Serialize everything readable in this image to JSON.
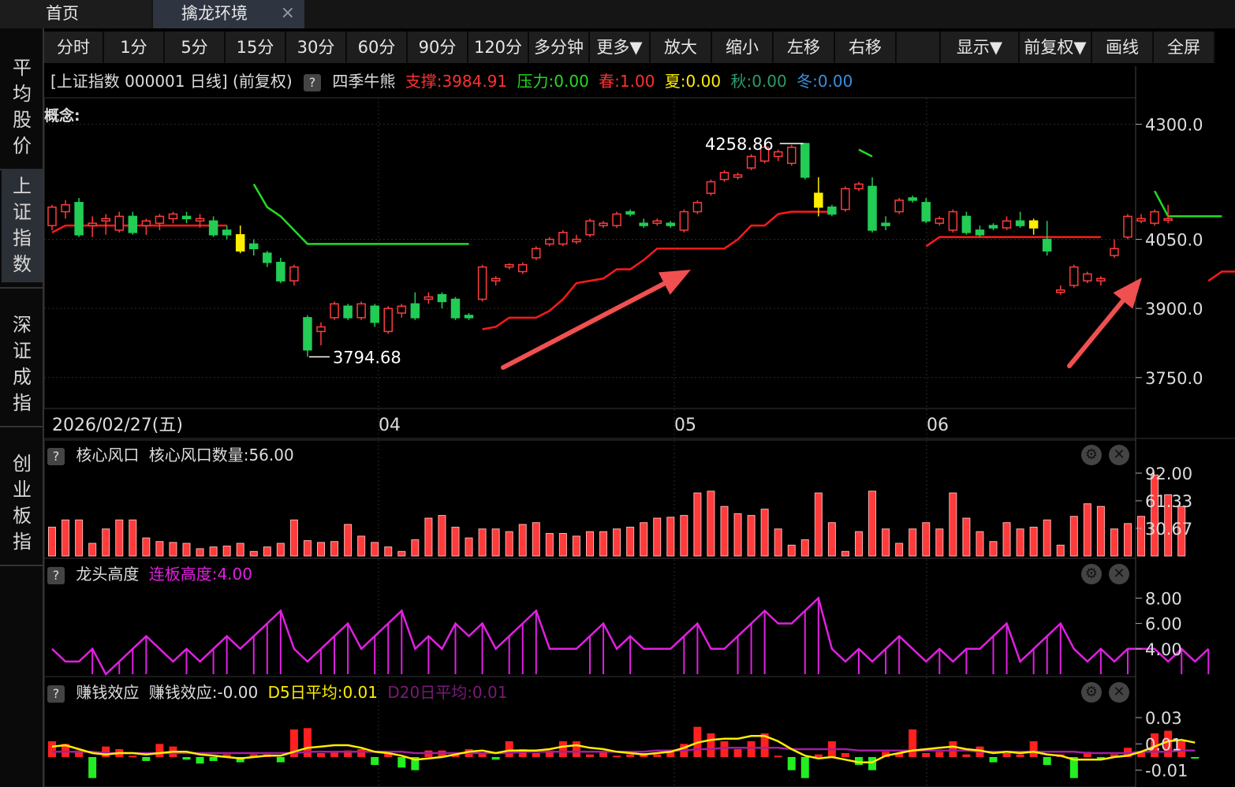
{
  "tabs": {
    "home": "首页",
    "env": "擒龙环境",
    "close": "×"
  },
  "sidebar": [
    "平均股价",
    "上证指数",
    "深证成指",
    "创业板指"
  ],
  "sidebar_active": 1,
  "toolbar": [
    "分时",
    "1分",
    "5分",
    "15分",
    "30分",
    "60分",
    "90分",
    "120分",
    "多分钟",
    "更多▼",
    "放大",
    "缩小",
    "左移",
    "右移",
    "",
    "显示▼",
    "前复权▼",
    "画线",
    "全屏"
  ],
  "info": {
    "title": "[上证指数 000001 日线] (前复权)",
    "help": "?",
    "indicator": "四季牛熊",
    "support": "支撑:3984.91",
    "pressure": "压力:0.00",
    "spring": "春:1.00",
    "summer": "夏:0.00",
    "autumn": "秋:0.00",
    "winter": "冬:0.00"
  },
  "concept_label": "概念:",
  "colors": {
    "up": "#ff3b3b",
    "down": "#22cc55",
    "yellow": "#ffee00",
    "magenta": "#e020e0",
    "support": "#ff1a1a",
    "pressure": "#22dd22"
  },
  "chart_data": [
    {
      "type": "candlestick",
      "yticks": [
        "4300.0",
        "4050.0",
        "3900.0",
        "3750.0"
      ],
      "ylim": [
        3700,
        4330
      ],
      "xticks": [
        "2026/02/27(五)",
        "04",
        "05",
        "06"
      ],
      "annotations": {
        "high": "4258.86",
        "low": "3794.68"
      },
      "candles": [
        [
          4080,
          4120,
          4070,
          4125
        ],
        [
          4110,
          4125,
          4095,
          4135
        ],
        [
          4130,
          4060,
          4055,
          4140
        ],
        [
          4080,
          4085,
          4055,
          4100
        ],
        [
          4090,
          4095,
          4060,
          4105
        ],
        [
          4070,
          4100,
          4065,
          4110
        ],
        [
          4100,
          4065,
          4060,
          4110
        ],
        [
          4080,
          4090,
          4060,
          4095
        ],
        [
          4085,
          4100,
          4070,
          4105
        ],
        [
          4095,
          4105,
          4085,
          4110
        ],
        [
          4100,
          4095,
          4085,
          4110
        ],
        [
          4090,
          4095,
          4075,
          4105
        ],
        [
          4090,
          4060,
          4055,
          4100
        ],
        [
          4070,
          4060,
          4050,
          4080
        ],
        [
          4060,
          4025,
          4020,
          4080
        ],
        [
          4040,
          4030,
          4015,
          4050
        ],
        [
          4020,
          4000,
          3990,
          4025
        ],
        [
          4000,
          3960,
          3955,
          4010
        ],
        [
          3960,
          3990,
          3950,
          3995
        ],
        [
          3880,
          3810,
          3795,
          3885
        ],
        [
          3850,
          3860,
          3820,
          3870
        ],
        [
          3880,
          3910,
          3875,
          3915
        ],
        [
          3905,
          3880,
          3875,
          3910
        ],
        [
          3880,
          3910,
          3875,
          3915
        ],
        [
          3905,
          3870,
          3860,
          3910
        ],
        [
          3850,
          3900,
          3845,
          3905
        ],
        [
          3890,
          3905,
          3880,
          3910
        ],
        [
          3910,
          3880,
          3875,
          3935
        ],
        [
          3920,
          3925,
          3910,
          3935
        ],
        [
          3930,
          3915,
          3900,
          3935
        ],
        [
          3920,
          3880,
          3875,
          3925
        ],
        [
          3885,
          3880,
          3875,
          3890
        ],
        [
          3920,
          3990,
          3915,
          3995
        ],
        [
          3960,
          3965,
          3950,
          3970
        ],
        [
          3990,
          3995,
          3985,
          3998
        ],
        [
          3980,
          3995,
          3975,
          4000
        ],
        [
          4010,
          4030,
          4005,
          4035
        ],
        [
          4040,
          4050,
          4035,
          4055
        ],
        [
          4040,
          4065,
          4035,
          4070
        ],
        [
          4045,
          4050,
          4040,
          4060
        ],
        [
          4060,
          4090,
          4055,
          4095
        ],
        [
          4080,
          4085,
          4075,
          4090
        ],
        [
          4080,
          4105,
          4075,
          4110
        ],
        [
          4110,
          4105,
          4100,
          4115
        ],
        [
          4085,
          4080,
          4075,
          4095
        ],
        [
          4085,
          4090,
          4080,
          4095
        ],
        [
          4085,
          4080,
          4075,
          4090
        ],
        [
          4070,
          4110,
          4065,
          4115
        ],
        [
          4110,
          4130,
          4105,
          4135
        ],
        [
          4150,
          4175,
          4145,
          4180
        ],
        [
          4180,
          4195,
          4175,
          4200
        ],
        [
          4185,
          4190,
          4180,
          4195
        ],
        [
          4205,
          4230,
          4200,
          4235
        ],
        [
          4220,
          4250,
          4215,
          4258
        ],
        [
          4230,
          4240,
          4220,
          4245
        ],
        [
          4215,
          4250,
          4210,
          4255
        ],
        [
          4258,
          4185,
          4180,
          4260
        ],
        [
          4150,
          4120,
          4100,
          4185
        ],
        [
          4120,
          4105,
          4100,
          4125
        ],
        [
          4115,
          4160,
          4110,
          4165
        ],
        [
          4160,
          4170,
          4155,
          4175
        ],
        [
          4165,
          4070,
          4065,
          4185
        ],
        [
          4085,
          4080,
          4070,
          4100
        ],
        [
          4110,
          4135,
          4105,
          4140
        ],
        [
          4140,
          4135,
          4130,
          4145
        ],
        [
          4130,
          4090,
          4085,
          4140
        ],
        [
          4085,
          4095,
          4080,
          4100
        ],
        [
          4070,
          4110,
          4065,
          4115
        ],
        [
          4100,
          4065,
          4060,
          4110
        ],
        [
          4070,
          4060,
          4055,
          4080
        ],
        [
          4080,
          4075,
          4070,
          4085
        ],
        [
          4075,
          4090,
          4070,
          4100
        ],
        [
          4090,
          4080,
          4075,
          4110
        ],
        [
          4075,
          4090,
          4060,
          4095
        ],
        [
          4050,
          4025,
          4015,
          4090
        ],
        [
          3935,
          3940,
          3930,
          3950
        ],
        [
          3950,
          3990,
          3945,
          3995
        ],
        [
          3960,
          3975,
          3955,
          3980
        ],
        [
          3960,
          3965,
          3950,
          3970
        ],
        [
          4015,
          4030,
          4010,
          4050
        ],
        [
          4055,
          4100,
          4050,
          4105
        ],
        [
          4090,
          4095,
          4085,
          4105
        ],
        [
          4085,
          4110,
          4080,
          4115
        ],
        [
          4095,
          4095,
          4085,
          4125
        ]
      ],
      "support_line": [
        [
          0,
          4065
        ],
        [
          1,
          4080
        ],
        [
          2,
          4080
        ],
        [
          3,
          4080
        ],
        [
          4,
          4080
        ],
        [
          5,
          4080
        ],
        [
          6,
          4080
        ],
        [
          7,
          4080
        ],
        [
          8,
          4080
        ],
        [
          9,
          4080
        ],
        [
          10,
          4080
        ],
        [
          11,
          4080
        ],
        [
          12,
          4080
        ],
        [
          13,
          4080
        ],
        null,
        [
          32,
          3855
        ],
        [
          33,
          3860
        ],
        [
          34,
          3880
        ],
        [
          35,
          3880
        ],
        [
          36,
          3880
        ],
        [
          37,
          3895
        ],
        [
          38,
          3920
        ],
        [
          39,
          3955
        ],
        [
          40,
          3960
        ],
        [
          41,
          3965
        ],
        [
          42,
          3985
        ],
        [
          43,
          3985
        ],
        [
          44,
          4005
        ],
        [
          45,
          4030
        ],
        [
          46,
          4030
        ],
        [
          47,
          4030
        ],
        [
          48,
          4030
        ],
        [
          49,
          4030
        ],
        [
          50,
          4030
        ],
        [
          51,
          4050
        ],
        [
          52,
          4080
        ],
        [
          53,
          4080
        ],
        [
          54,
          4105
        ],
        [
          55,
          4110
        ],
        [
          56,
          4110
        ],
        [
          57,
          4110
        ],
        [
          58,
          4110
        ],
        null,
        [
          65,
          4035
        ],
        [
          66,
          4055
        ],
        [
          67,
          4055
        ],
        [
          68,
          4055
        ],
        [
          69,
          4055
        ],
        [
          70,
          4055
        ],
        [
          71,
          4055
        ],
        [
          72,
          4055
        ],
        [
          73,
          4055
        ],
        [
          74,
          4055
        ],
        [
          75,
          4055
        ],
        [
          76,
          4055
        ],
        [
          77,
          4055
        ],
        [
          78,
          4055
        ],
        null,
        [
          86,
          3960
        ],
        [
          87,
          3980
        ],
        [
          88,
          3980
        ],
        [
          89,
          3985
        ]
      ],
      "pressure_line": [
        [
          15,
          4170
        ],
        [
          16,
          4120
        ],
        [
          17,
          4100
        ],
        [
          18,
          4070
        ],
        [
          19,
          4040
        ],
        [
          20,
          4040
        ],
        [
          21,
          4040
        ],
        [
          22,
          4040
        ],
        [
          23,
          4040
        ],
        [
          24,
          4040
        ],
        [
          25,
          4040
        ],
        [
          26,
          4040
        ],
        [
          27,
          4040
        ],
        [
          28,
          4040
        ],
        [
          29,
          4040
        ],
        [
          30,
          4040
        ],
        [
          31,
          4040
        ],
        null,
        [
          60,
          4245
        ],
        [
          61,
          4230
        ],
        null,
        [
          82,
          4155
        ],
        [
          83,
          4100
        ],
        [
          84,
          4100
        ],
        [
          85,
          4100
        ],
        [
          86,
          4100
        ],
        [
          87,
          4100
        ]
      ]
    },
    {
      "type": "bar",
      "name": "核心风口",
      "label": "核心风口数量:56.00",
      "yticks": [
        "92.00",
        "61.33",
        "30.67"
      ],
      "ylim": [
        0,
        92
      ],
      "values": [
        32,
        40,
        40,
        14,
        30,
        40,
        40,
        20,
        16,
        15,
        14,
        8,
        10,
        11,
        14,
        5,
        10,
        14,
        40,
        17,
        15,
        16,
        35,
        22,
        15,
        10,
        5,
        18,
        42,
        45,
        32,
        20,
        30,
        30,
        27,
        35,
        37,
        25,
        25,
        22,
        27,
        27,
        30,
        32,
        37,
        42,
        43,
        45,
        70,
        72,
        55,
        47,
        45,
        52,
        30,
        12,
        18,
        70,
        37,
        5,
        27,
        72,
        30,
        14,
        30,
        37,
        30,
        70,
        42,
        27,
        16,
        37,
        30,
        32,
        40,
        12,
        44,
        58,
        55,
        30,
        36,
        44,
        90,
        68,
        55
      ]
    },
    {
      "type": "line",
      "name": "龙头高度",
      "label": "连板高度:4.00",
      "yticks": [
        "8.00",
        "6.00",
        "4.00"
      ],
      "ylim": [
        2,
        8.4
      ],
      "values": [
        4,
        3,
        3,
        4,
        2,
        3,
        4,
        5,
        4,
        3,
        4,
        3,
        4,
        5,
        4,
        5,
        6,
        7,
        4,
        3,
        4,
        5,
        6,
        4,
        5,
        6,
        7,
        4,
        5,
        4,
        6,
        5,
        6,
        4,
        5,
        6,
        7,
        4,
        4,
        4,
        5,
        6,
        4,
        5,
        4,
        4,
        4,
        5,
        6,
        4,
        4,
        5,
        6,
        7,
        6,
        6,
        7,
        8,
        4,
        3,
        4,
        3,
        4,
        5,
        4,
        3,
        4,
        3,
        4,
        4,
        5,
        6,
        3,
        4,
        5,
        6,
        4,
        3,
        4,
        3,
        4,
        4,
        4,
        3,
        4,
        3,
        4
      ]
    },
    {
      "type": "bar",
      "name": "赚钱效应",
      "label": "赚钱效应:-0.00",
      "d5": "D5日平均:0.01",
      "d20": "D20日平均:0.01",
      "yticks": [
        "0.03",
        "0.01",
        "-0.01"
      ],
      "ylim": [
        -0.018,
        0.036
      ],
      "values": [
        0.012,
        0.01,
        0.005,
        -0.016,
        0.008,
        0.006,
        0.001,
        -0.003,
        0.01,
        0.008,
        -0.002,
        -0.005,
        -0.003,
        0.002,
        -0.004,
        0.002,
        0.002,
        -0.004,
        0.021,
        0.022,
        0.003,
        0.004,
        0.005,
        0.006,
        -0.006,
        0.003,
        -0.008,
        -0.01,
        0.005,
        0.005,
        0.002,
        0.006,
        0.003,
        -0.002,
        0.012,
        0.006,
        0.003,
        0.005,
        0.012,
        0.012,
        0.002,
        0.004,
        0.001,
        0.002,
        0.003,
        0.002,
        0.004,
        0.01,
        0.023,
        0.018,
        0.012,
        0.006,
        0.012,
        0.018,
        0.001,
        -0.01,
        -0.016,
        0.002,
        0.012,
        0.003,
        -0.006,
        -0.01,
        0.004,
        0.003,
        0.021,
        0.003,
        0.004,
        0.012,
        0.002,
        0.008,
        -0.004,
        0.003,
        0.002,
        0.012,
        -0.006,
        0.002,
        -0.016,
        0.004,
        -0.002,
        0.002,
        0.007,
        0.004,
        0.018,
        0.02,
        0.012,
        -0.001
      ],
      "d5_values": [
        0.008,
        0.009,
        0.006,
        0.003,
        0.002,
        0.003,
        0.003,
        0.002,
        0.003,
        0.004,
        0.004,
        0.002,
        0.001,
        0.0,
        -0.001,
        0.0,
        0.001,
        0.001,
        0.004,
        0.007,
        0.008,
        0.009,
        0.009,
        0.007,
        0.004,
        0.003,
        0.001,
        -0.002,
        -0.001,
        0.0,
        0.002,
        0.004,
        0.005,
        0.003,
        0.005,
        0.005,
        0.005,
        0.006,
        0.008,
        0.009,
        0.007,
        0.006,
        0.004,
        0.003,
        0.002,
        0.003,
        0.004,
        0.007,
        0.011,
        0.013,
        0.014,
        0.014,
        0.016,
        0.016,
        0.012,
        0.006,
        0.001,
        -0.001,
        0.0,
        -0.002,
        -0.004,
        -0.004,
        0.001,
        0.003,
        0.005,
        0.006,
        0.007,
        0.008,
        0.006,
        0.005,
        0.003,
        0.004,
        0.003,
        0.004,
        0.002,
        0.001,
        -0.002,
        -0.002,
        -0.002,
        0.0,
        0.001,
        0.004,
        0.008,
        0.012,
        0.013,
        0.011
      ],
      "d20_values": [
        0.004,
        0.004,
        0.004,
        0.004,
        0.003,
        0.003,
        0.003,
        0.003,
        0.003,
        0.003,
        0.003,
        0.003,
        0.003,
        0.003,
        0.003,
        0.003,
        0.003,
        0.003,
        0.003,
        0.004,
        0.004,
        0.004,
        0.004,
        0.004,
        0.004,
        0.004,
        0.004,
        0.003,
        0.003,
        0.003,
        0.003,
        0.003,
        0.003,
        0.003,
        0.003,
        0.004,
        0.004,
        0.004,
        0.004,
        0.004,
        0.004,
        0.004,
        0.004,
        0.004,
        0.004,
        0.005,
        0.005,
        0.005,
        0.006,
        0.006,
        0.007,
        0.007,
        0.007,
        0.007,
        0.007,
        0.006,
        0.006,
        0.006,
        0.006,
        0.006,
        0.005,
        0.005,
        0.005,
        0.005,
        0.005,
        0.005,
        0.005,
        0.005,
        0.005,
        0.004,
        0.004,
        0.004,
        0.004,
        0.004,
        0.004,
        0.004,
        0.004,
        0.003,
        0.003,
        0.003,
        0.003,
        0.004,
        0.004,
        0.004,
        0.005,
        0.005
      ]
    }
  ]
}
